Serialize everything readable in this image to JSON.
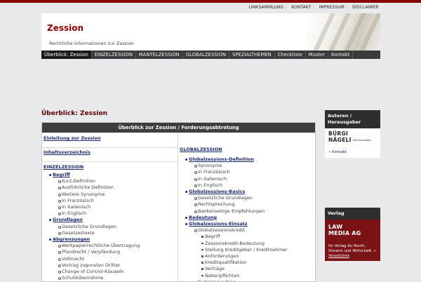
{
  "top_links": [
    "LINKSAMMLUNG",
    "KONTAKT",
    "IMPRESSUM",
    "DISCLAIMER"
  ],
  "header": {
    "title": "Zession",
    "subtitle": "Rechtliche Informationen zur Zession"
  },
  "nav": [
    {
      "label": "Überblick: Zession",
      "active": true
    },
    {
      "label": "EINZELZESSION"
    },
    {
      "label": "MANTELZESSION"
    },
    {
      "label": "GLOBALZESSION"
    },
    {
      "label": "SPEZIALTHEMEN"
    },
    {
      "label": "Checkliste"
    },
    {
      "label": "Muster"
    },
    {
      "label": "Kontakt"
    }
  ],
  "page_title": "Überblick: Zession",
  "box_title": "Überblick zur Zession / Forderungsabtretung",
  "left": {
    "intro": "Einleitung zur Zession",
    "toc": "Inhaltsverzeichnis",
    "section": "EINZELZESSION",
    "items": [
      {
        "t": "Begriff",
        "lvl": 1
      },
      {
        "t": "Kurz-Definition",
        "lvl": 2
      },
      {
        "t": "Ausführliche Definition",
        "lvl": 2
      },
      {
        "t": "Weitere Synonyme",
        "lvl": 2
      },
      {
        "t": "In Französisch",
        "lvl": 2
      },
      {
        "t": "In Italienisch",
        "lvl": 2
      },
      {
        "t": "In Englisch",
        "lvl": 2
      },
      {
        "t": "Grundlagen",
        "lvl": 1
      },
      {
        "t": "Gesetzliche Grundlagen",
        "lvl": 2
      },
      {
        "t": "Gesetzestexte",
        "lvl": 2
      },
      {
        "t": "Abgrenzungen",
        "lvl": 1
      },
      {
        "t": "Wertpapierrechtliche Übertragung",
        "lvl": 2
      },
      {
        "t": "Pfandrecht / Verpfändung",
        "lvl": 2
      },
      {
        "t": "Vollmacht",
        "lvl": 2
      },
      {
        "t": "Vertrag zugunsten Dritter",
        "lvl": 2
      },
      {
        "t": "Change of Control-Klauseln",
        "lvl": 2
      },
      {
        "t": "Schuldübernahme",
        "lvl": 2
      }
    ]
  },
  "right": {
    "section": "GLOBALZESSION",
    "items": [
      {
        "t": "Globalzessions-Definition",
        "lvl": 1
      },
      {
        "t": "Synonyme",
        "lvl": 2
      },
      {
        "t": "In Französisch",
        "lvl": 2
      },
      {
        "t": "In Italienisch",
        "lvl": 2
      },
      {
        "t": "In Englisch",
        "lvl": 2
      },
      {
        "t": "Globalzessions-Basics",
        "lvl": 1
      },
      {
        "t": "Gesetzliche Grundlagen",
        "lvl": 2
      },
      {
        "t": "Rechtsprechung",
        "lvl": 2
      },
      {
        "t": "Bankenseitige Empfehlungen",
        "lvl": 2
      },
      {
        "t": "Bedeutung",
        "lvl": 1
      },
      {
        "t": "Globalzessions-Einsatz",
        "lvl": 1
      },
      {
        "t": "Globalzessionskredit",
        "lvl": 2
      },
      {
        "t": "Begriff",
        "lvl": 3
      },
      {
        "t": "Zessionskredit-Bedeutung",
        "lvl": 3
      },
      {
        "t": "Stellung Kreditgeber / Kreditnehmer",
        "lvl": 3
      },
      {
        "t": "Anforderungen",
        "lvl": 3
      },
      {
        "t": "Kreditqualifikation",
        "lvl": 3
      },
      {
        "t": "Verträge",
        "lvl": 3
      },
      {
        "t": "Nebenpflichten",
        "lvl": 3
      },
      {
        "t": "Factoringvertrag",
        "lvl": 2
      }
    ]
  },
  "sidebar_authors": {
    "heading": "Autoren / Herausgeber",
    "logo_line1": "BÜRGI",
    "logo_line2": "NÄGELI",
    "logo_tag": "Rechtsanwälte",
    "link": "Kontakt"
  },
  "sidebar_publisher": {
    "heading": "Verlag",
    "logo_line1": "LAW",
    "logo_line2": "MEDIA AG",
    "text": "Ihr Verlag für Recht, Steuern und Wirtschaft.",
    "link": "Verzeichnis"
  },
  "colors": {
    "brand": "#8b0000",
    "nav_bg": "#3a3a3a",
    "link": "#1a2a6c",
    "publisher_bg": "#7a1216"
  }
}
